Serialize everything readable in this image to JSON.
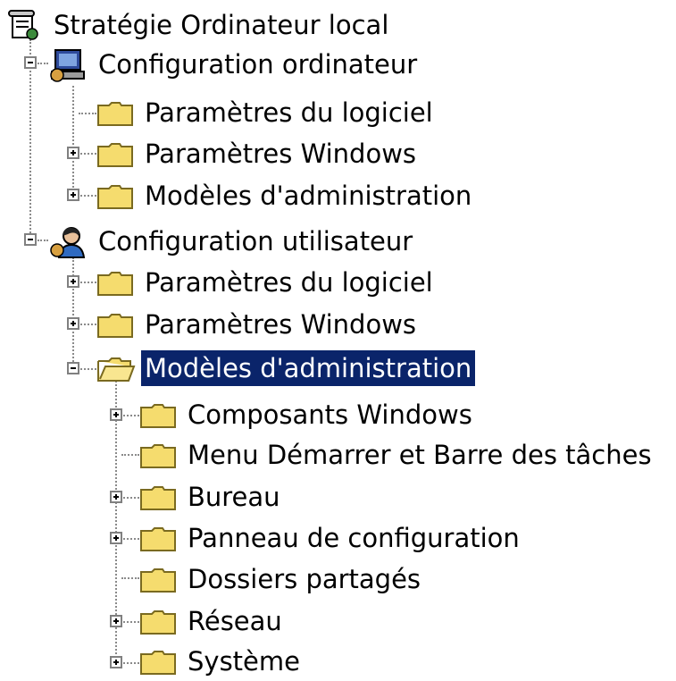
{
  "tree": {
    "root": {
      "label": "Stratégie Ordinateur local",
      "icon": "policy-scroll-icon"
    },
    "computer_config": {
      "label": "Configuration ordinateur",
      "icon": "computer-config-icon",
      "expanded": true,
      "children": [
        {
          "label": "Paramètres du logiciel",
          "icon": "folder-icon",
          "has_children": false
        },
        {
          "label": "Paramètres Windows",
          "icon": "folder-icon",
          "has_children": true
        },
        {
          "label": "Modèles d'administration",
          "icon": "folder-icon",
          "has_children": true
        }
      ]
    },
    "user_config": {
      "label": "Configuration utilisateur",
      "icon": "user-config-icon",
      "expanded": true,
      "children": [
        {
          "label": "Paramètres du logiciel",
          "icon": "folder-icon",
          "has_children": true
        },
        {
          "label": "Paramètres Windows",
          "icon": "folder-icon",
          "has_children": true
        },
        {
          "label": "Modèles d'administration",
          "icon": "folder-open-icon",
          "expanded": true,
          "selected": true,
          "children": [
            {
              "label": "Composants Windows",
              "icon": "folder-icon",
              "has_children": true
            },
            {
              "label": "Menu Démarrer et Barre des tâches",
              "icon": "folder-icon",
              "has_children": false
            },
            {
              "label": "Bureau",
              "icon": "folder-icon",
              "has_children": true
            },
            {
              "label": "Panneau de configuration",
              "icon": "folder-icon",
              "has_children": true
            },
            {
              "label": "Dossiers partagés",
              "icon": "folder-icon",
              "has_children": false
            },
            {
              "label": "Réseau",
              "icon": "folder-icon",
              "has_children": true
            },
            {
              "label": "Système",
              "icon": "folder-icon",
              "has_children": true
            }
          ]
        }
      ]
    }
  },
  "colors": {
    "selection": "#0a246a",
    "folder": "#f5dc6e",
    "tree_line": "#8a8a8a"
  }
}
